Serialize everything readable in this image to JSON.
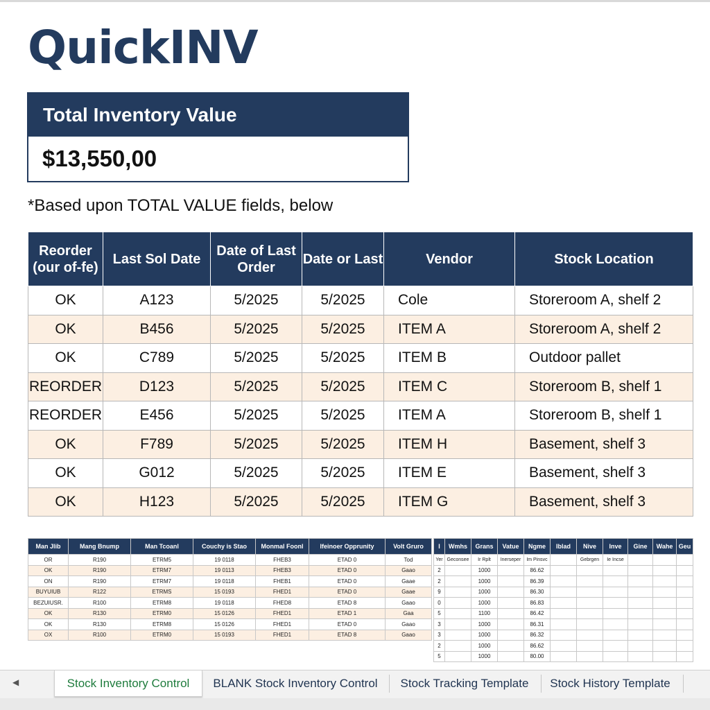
{
  "app": {
    "title": "QuickINV"
  },
  "kpi": {
    "label": "Total Inventory Value",
    "value": "$13,550,00"
  },
  "note": "*Based upon TOTAL VALUE fields, below",
  "main_table": {
    "headers": [
      "Reorder (our of-fe)",
      "Last Sol Date",
      "Date of Last Order",
      "Date or Last",
      "Vendor",
      "Stock Location"
    ],
    "rows": [
      [
        "OK",
        "A123",
        "5/2025",
        "5/2025",
        "Cole",
        "Storeroom A, shelf 2"
      ],
      [
        "OK",
        "B456",
        "5/2025",
        "5/2025",
        "ITEM A",
        "Storeroom A, shelf 2"
      ],
      [
        "OK",
        "C789",
        "5/2025",
        "5/2025",
        "ITEM B",
        "Outdoor pallet"
      ],
      [
        "REORDER",
        "D123",
        "5/2025",
        "5/2025",
        "ITEM C",
        "Storeroom B, shelf 1"
      ],
      [
        "REORDER",
        "E456",
        "5/2025",
        "5/2025",
        "ITEM A",
        "Storeroom B, shelf 1"
      ],
      [
        "OK",
        "F789",
        "5/2025",
        "5/2025",
        "ITEM H",
        "Basement, shelf 3"
      ],
      [
        "OK",
        "G012",
        "5/2025",
        "5/2025",
        "ITEM E",
        "Basement, shelf 3"
      ],
      [
        "OK",
        "H123",
        "5/2025",
        "5/2025",
        "ITEM G",
        "Basement, shelf 3"
      ]
    ]
  },
  "mini_table_1": {
    "headers": [
      "Man Jlib",
      "Mang Bnump",
      "Man Tcoanl",
      "Couchy is Stao",
      "Monmal Foonl",
      "Ifeinoer Opprunity",
      "Volt Gruro"
    ],
    "rows": [
      [
        "OR",
        "R190",
        "ETRM5",
        "19 0118",
        "FHEB3",
        "ETAD 0",
        "Tod"
      ],
      [
        "OK",
        "R190",
        "ETRM7",
        "19 0113",
        "FHEB3",
        "ETAD 0",
        "Gaao"
      ],
      [
        "ON",
        "R190",
        "ETRM7",
        "19 0118",
        "FHEB1",
        "ETAD 0",
        "Gaae"
      ],
      [
        "BUYUIUB",
        "R122",
        "ETRMS",
        "15 0193",
        "FHED1",
        "ETAD 0",
        "Gaae"
      ],
      [
        "BEZUIUSR.",
        "R100",
        "ETRM8",
        "19 0118",
        "FHED8",
        "ETAD 8",
        "Gaao"
      ],
      [
        "OK",
        "R130",
        "ETRM0",
        "15 0126",
        "FHED1",
        "ETAD 1",
        "Gaa"
      ],
      [
        "OK",
        "R130",
        "ETRM8",
        "15 0126",
        "FHED1",
        "ETAD 0",
        "Gaao"
      ],
      [
        "OX",
        "R100",
        "ETRM0",
        "15 0193",
        "FHED1",
        "ETAD 8",
        "Gaao"
      ]
    ]
  },
  "mini_table_2": {
    "headers": [
      "I",
      "Wmhs",
      "Grans",
      "Vatue",
      "Ngme",
      "Iblad",
      "Nive",
      "Inve",
      "Gine",
      "Wahe",
      "Geu"
    ],
    "subheaders": [
      "Yer",
      "Geconsee",
      "Ir Rplt",
      "Inerseper",
      "Im Pinsvc",
      "",
      "Gebrgen",
      "Ie Incse",
      "",
      "",
      ""
    ],
    "rows": [
      [
        "2",
        "",
        "1000",
        "",
        "86.62",
        "",
        "",
        "",
        "",
        "",
        ""
      ],
      [
        "2",
        "",
        "1000",
        "",
        "86.39",
        "",
        "",
        "",
        "",
        "",
        ""
      ],
      [
        "9",
        "",
        "1000",
        "",
        "86.30",
        "",
        "",
        "",
        "",
        "",
        ""
      ],
      [
        "0",
        "",
        "1000",
        "",
        "86.83",
        "",
        "",
        "",
        "",
        "",
        ""
      ],
      [
        "5",
        "",
        "1100",
        "",
        "86.42",
        "",
        "",
        "",
        "",
        "",
        ""
      ],
      [
        "3",
        "",
        "1000",
        "",
        "86.31",
        "",
        "",
        "",
        "",
        "",
        ""
      ],
      [
        "3",
        "",
        "1000",
        "",
        "86.32",
        "",
        "",
        "",
        "",
        "",
        ""
      ],
      [
        "2",
        "",
        "1000",
        "",
        "86.62",
        "",
        "",
        "",
        "",
        "",
        ""
      ],
      [
        "5",
        "",
        "1000",
        "",
        "80.00",
        "",
        "",
        "",
        "",
        "",
        ""
      ]
    ]
  },
  "sheet_tabs": {
    "nav_icon": "caret-left-icon",
    "tabs": [
      "Stock Inventory Control",
      "BLANK Stock Inventory Control",
      "Stock Tracking Template",
      "Stock History Template"
    ],
    "active_index": 0
  },
  "colors": {
    "header_navy": "#233b5e",
    "row_band": "#fcefe2",
    "active_tab_text": "#1e7b3c"
  }
}
